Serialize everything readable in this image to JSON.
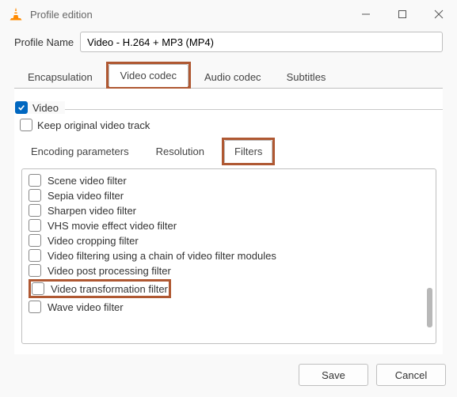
{
  "window": {
    "title": "Profile edition"
  },
  "profile": {
    "label": "Profile Name",
    "value": "Video - H.264 + MP3 (MP4)"
  },
  "tabs": {
    "encapsulation": "Encapsulation",
    "video_codec": "Video codec",
    "audio_codec": "Audio codec",
    "subtitles": "Subtitles",
    "selected": "video_codec"
  },
  "video_section": {
    "video_label": "Video",
    "keep_original_label": "Keep original video track"
  },
  "subtabs": {
    "encoding": "Encoding parameters",
    "resolution": "Resolution",
    "filters": "Filters",
    "selected": "filters"
  },
  "filters": [
    "Scene video filter",
    "Sepia video filter",
    "Sharpen video filter",
    "VHS movie effect video filter",
    "Video cropping filter",
    "Video filtering using a chain of video filter modules",
    "Video post processing filter",
    "Video transformation filter",
    "Wave video filter"
  ],
  "buttons": {
    "save": "Save",
    "cancel": "Cancel"
  }
}
